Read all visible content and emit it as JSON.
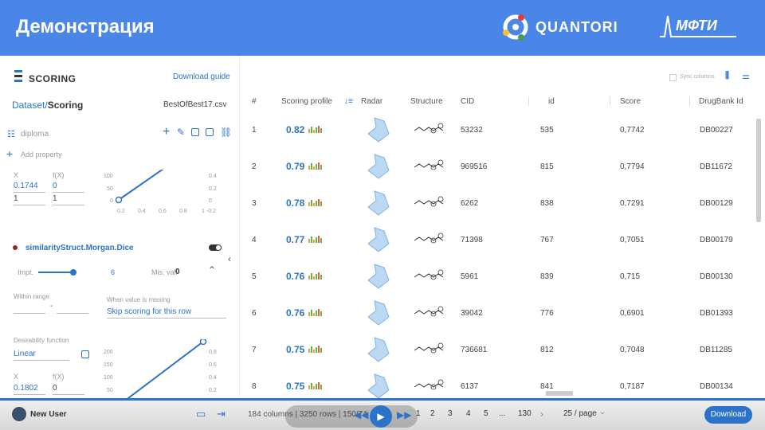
{
  "banner": {
    "title": "Демонстрация",
    "logo_text": "QUANTORI",
    "logo2_text": "МФТИ"
  },
  "app": {
    "name": "SCORING",
    "download_guide": "Download guide",
    "breadcrumb_dataset": "Dataset/",
    "breadcrumb_scoring": "Scoring",
    "file": "BestOfBest17.csv"
  },
  "left": {
    "profile": "diploma",
    "add_property": "Add property",
    "fn1": {
      "x_label": "X",
      "fx_label": "f(X)",
      "x1": "0.1744",
      "fx1": "0",
      "x2": "1",
      "fx2": "1"
    },
    "plot1": {
      "y_ticks": [
        "100",
        "50",
        "0"
      ],
      "x_ticks": [
        "0.2",
        "0.4",
        "0.6",
        "0.8",
        "1"
      ],
      "r_ticks": [
        "0.4",
        "0.2",
        "0",
        "-0.2"
      ]
    },
    "property": "similarityStruct.Morgan.Dice",
    "impt_label": "Impt.",
    "impt_value": "6",
    "mis_label": "Mis. val.",
    "mis_value": "0",
    "within_range": "Within range",
    "range_dash": "-",
    "missing_label": "When value is missing",
    "missing_action": "Skip scoring for this row",
    "desirability_label": "Desirability function",
    "desirability_value": "Linear",
    "plot2": {
      "y_ticks": [
        "200",
        "150",
        "100",
        "50"
      ],
      "r_ticks": [
        "0.8",
        "0.6",
        "0.4",
        "0.2"
      ]
    },
    "fn2": {
      "x_label": "X",
      "fx_label": "f(X)",
      "x1": "0.1802",
      "fx1": "0"
    }
  },
  "grid": {
    "sync_columns": "Sync columns",
    "headers": {
      "num": "#",
      "profile": "Scoring profile",
      "radar": "Radar",
      "structure": "Structure",
      "cid": "CID",
      "id": "id",
      "score": "Score",
      "drugbank": "DrugBank Id"
    },
    "rows": [
      {
        "n": "1",
        "profile": "0.82",
        "cid": "53232",
        "id": "535",
        "score": "0,7742",
        "db": "DB00227"
      },
      {
        "n": "2",
        "profile": "0.79",
        "cid": "969516",
        "id": "815",
        "score": "0,7794",
        "db": "DB11672"
      },
      {
        "n": "3",
        "profile": "0.78",
        "cid": "6262",
        "id": "838",
        "score": "0,7291",
        "db": "DB00129"
      },
      {
        "n": "4",
        "profile": "0.77",
        "cid": "71398",
        "id": "767",
        "score": "0,7051",
        "db": "DB00179"
      },
      {
        "n": "5",
        "profile": "0.76",
        "cid": "5961",
        "id": "839",
        "score": "0,715",
        "db": "DB00130"
      },
      {
        "n": "6",
        "profile": "0.76",
        "cid": "39042",
        "id": "776",
        "score": "0,6901",
        "db": "DB01393"
      },
      {
        "n": "7",
        "profile": "0.75",
        "cid": "736681",
        "id": "812",
        "score": "0,7048",
        "db": "DB11285"
      },
      {
        "n": "8",
        "profile": "0.75",
        "cid": "6137",
        "id": "841",
        "score": "0,7187",
        "db": "DB00134"
      }
    ]
  },
  "bottom": {
    "user": "New User",
    "columns": "184 columns | 3250 rows | 150/74",
    "pages": [
      "1",
      "2",
      "3",
      "4",
      "5",
      "...",
      "130"
    ],
    "page_size": "25 / page",
    "download": "Download"
  },
  "colors": {
    "banner": "#4a86e8",
    "accent": "#2a73c9"
  }
}
